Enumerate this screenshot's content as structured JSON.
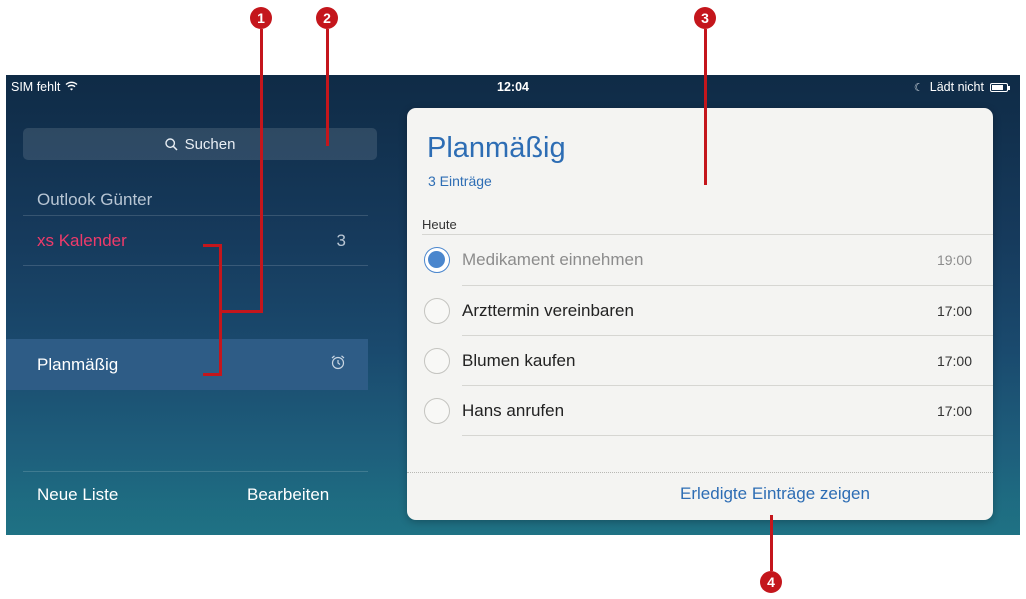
{
  "status_bar": {
    "carrier": "SIM fehlt",
    "time": "12:04",
    "charging": "Lädt nicht"
  },
  "sidebar": {
    "search_placeholder": "Suchen",
    "account_title": "Outlook Günter",
    "lists": [
      {
        "label": "xs Kalender",
        "count": "3",
        "color": "#ee3a6a"
      },
      {
        "label": "Planmäßig",
        "icon": "alarm-clock-icon"
      }
    ],
    "new_list": "Neue Liste",
    "edit": "Bearbeiten"
  },
  "card": {
    "title": "Planmäßig",
    "subtitle": "3 Einträge",
    "section": "Heute",
    "tasks": [
      {
        "name": "Medikament einnehmen",
        "time": "19:00",
        "completed": true
      },
      {
        "name": "Arzttermin vereinbaren",
        "time": "17:00",
        "completed": false
      },
      {
        "name": "Blumen kaufen",
        "time": "17:00",
        "completed": false
      },
      {
        "name": "Hans anrufen",
        "time": "17:00",
        "completed": false
      }
    ],
    "show_completed": "Erledigte Einträge zeigen"
  },
  "callouts": [
    "1",
    "2",
    "3",
    "4"
  ],
  "colors": {
    "accent": "#2d6db4",
    "list_color": "#ee3a6a",
    "callout": "#c4161c",
    "selected_row": "#2e5c86"
  }
}
